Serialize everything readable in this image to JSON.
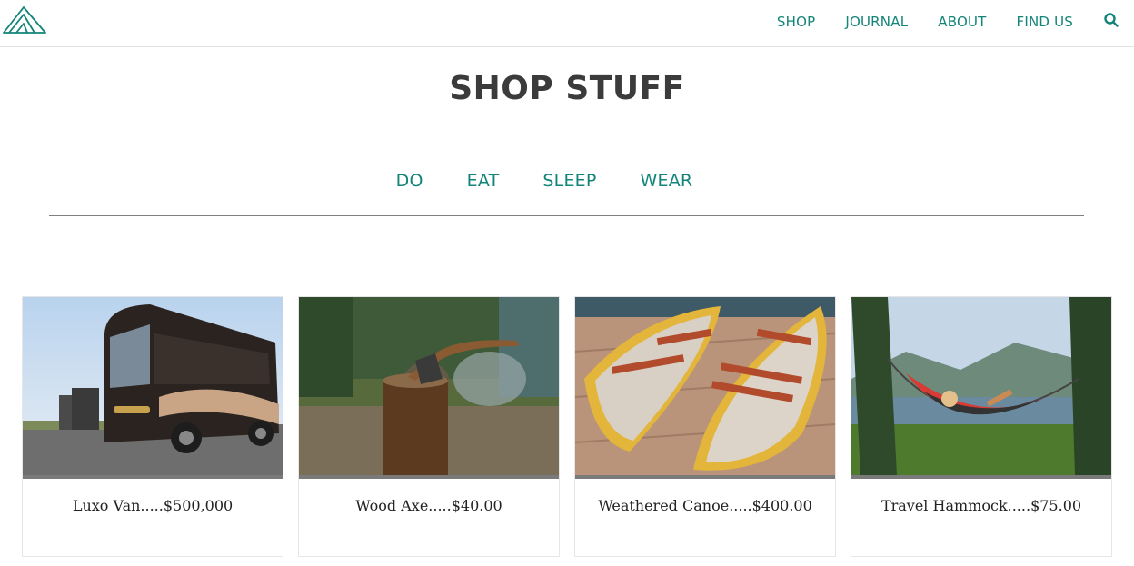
{
  "nav": {
    "items": [
      {
        "label": "SHOP"
      },
      {
        "label": "JOURNAL"
      },
      {
        "label": "ABOUT"
      },
      {
        "label": "FIND US"
      }
    ],
    "search_icon": "search-icon"
  },
  "page": {
    "title": "SHOP STUFF"
  },
  "categories": [
    {
      "label": "DO"
    },
    {
      "label": "EAT"
    },
    {
      "label": "SLEEP"
    },
    {
      "label": "WEAR"
    }
  ],
  "products": [
    {
      "name": "Luxo Van",
      "separator": ".....",
      "price": "$500,000",
      "caption": "Luxo Van.....$500,000"
    },
    {
      "name": "Wood Axe",
      "separator": ".....",
      "price": "$40.00",
      "caption": "Wood Axe.....$40.00"
    },
    {
      "name": "Weathered Canoe",
      "separator": ".....",
      "price": "$400.00",
      "caption": "Weathered Canoe.....$400.00"
    },
    {
      "name": "Travel Hammock",
      "separator": ".....",
      "price": "$75.00",
      "caption": "Travel Hammock.....$75.00"
    }
  ],
  "colors": {
    "accent": "#138478",
    "title": "#3b3b3b",
    "divider": "#808080"
  }
}
